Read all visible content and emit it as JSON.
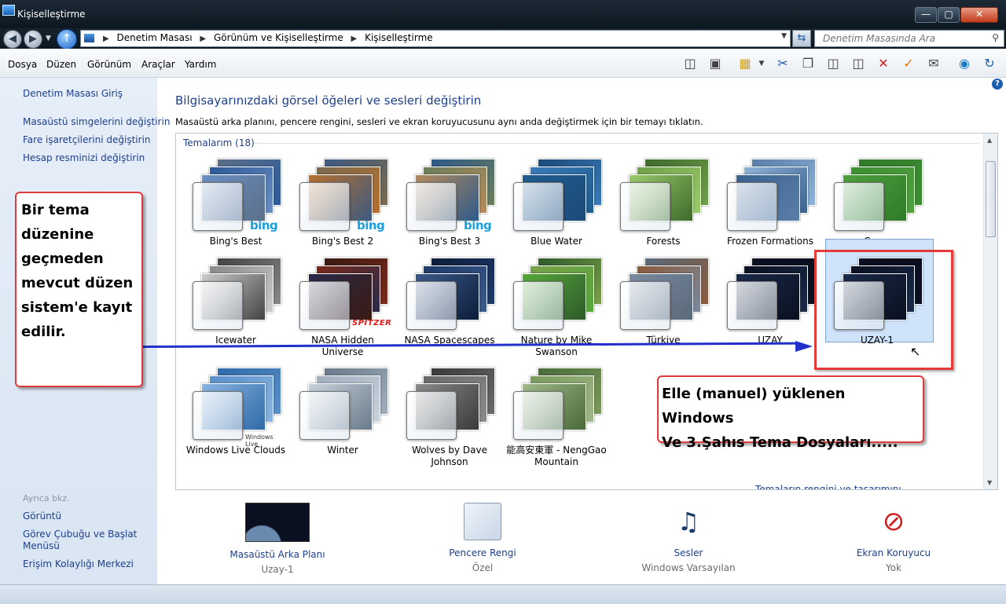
{
  "window": {
    "title": "Kişiselleştirme",
    "controls": {
      "minimize": "—",
      "maximize": "▢",
      "close": "✕"
    }
  },
  "address": {
    "crumbs": [
      "Denetim Masası",
      "Görünüm ve Kişiselleştirme",
      "Kişiselleştirme"
    ],
    "search_placeholder": "Denetim Masasında Ara"
  },
  "menu": [
    "Dosya",
    "Düzen",
    "Görünüm",
    "Araçlar",
    "Yardım"
  ],
  "toolbar_icons": [
    "panel-view-icon",
    "preview-pane-icon",
    "folder-icon",
    "scissors-icon",
    "copy-icon",
    "paste-icon",
    "paste-alt-icon",
    "delete-icon",
    "check-icon",
    "mail-icon",
    "globe-icon",
    "refresh-icon",
    "help-icon"
  ],
  "sidebar": {
    "home": "Denetim Masası Giriş",
    "tasks": [
      "Masaüstü simgelerini değiştirin",
      "Fare işaretçilerini değiştirin",
      "Hesap resminizi değiştirin"
    ],
    "see_also_title": "Ayrıca bkz.",
    "see_also": [
      "Görüntü",
      "Görev Çubuğu ve Başlat Menüsü",
      "Erişim Kolaylığı Merkezi"
    ]
  },
  "main": {
    "heading": "Bilgisayarınızdaki görsel öğeleri ve sesleri değiştirin",
    "subheading": "Masaüstü arka planını, pencere rengini, sesleri ve ekran koruyucusunu aynı anda değiştirmek için bir temayı tıklatın.",
    "group_label": "Temalarım (18)",
    "themes": [
      {
        "name": "Bing's Best",
        "brand": "bing",
        "colors": [
          "#5b6f88",
          "#2d5a9a",
          "#6a8fc2"
        ]
      },
      {
        "name": "Bing's Best 2",
        "brand": "bing",
        "colors": [
          "#3d5a80",
          "#7a6a50",
          "#b5702e"
        ]
      },
      {
        "name": "Bing's Best 3",
        "brand": "bing",
        "colors": [
          "#2e5a8a",
          "#6b7e5a",
          "#b48a5c"
        ]
      },
      {
        "name": "Blue Water",
        "brand": "",
        "colors": [
          "#1d4a7a",
          "#3a7ab8",
          "#1f5c8e"
        ]
      },
      {
        "name": "Forests",
        "brand": "",
        "colors": [
          "#3e6a2c",
          "#6fa04a",
          "#9acb6a"
        ]
      },
      {
        "name": "Frozen Formations",
        "brand": "",
        "colors": [
          "#5a7ea8",
          "#8eb3d8",
          "#3b6390"
        ]
      },
      {
        "name": "Grass",
        "brand": "",
        "colors": [
          "#2f7a2a",
          "#3f8e33",
          "#4ea03d"
        ]
      },
      {
        "name": "Icewater",
        "brand": "",
        "colors": [
          "#444444",
          "#888888",
          "#cccccc"
        ]
      },
      {
        "name": "NASA Hidden Universe",
        "brand": "SPITZER",
        "colors": [
          "#3a1a12",
          "#7a2a1a",
          "#2a2a4a"
        ]
      },
      {
        "name": "NASA Spacescapes",
        "brand": "",
        "colors": [
          "#0d1d3a",
          "#1f3a6a",
          "#3a5a8a"
        ]
      },
      {
        "name": "Nature by Mike Swanson",
        "brand": "",
        "colors": [
          "#2e5a2a",
          "#7aa04a",
          "#56a83a"
        ]
      },
      {
        "name": "Türkiye",
        "brand": "",
        "colors": [
          "#5a6a7a",
          "#8a5a3a",
          "#7a8aa0"
        ]
      },
      {
        "name": "UZAY",
        "brand": "",
        "colors": [
          "#0a1020",
          "#0a1020",
          "#1a2a4a"
        ]
      },
      {
        "name": "UZAY-1",
        "brand": "",
        "colors": [
          "#0a1020",
          "#0a1020",
          "#1a2a4a"
        ],
        "selected": true
      },
      {
        "name": "Windows Live Clouds",
        "brand": "Windows Live",
        "colors": [
          "#2e6aa8",
          "#5b8fc8",
          "#8ab4e0"
        ]
      },
      {
        "name": "Winter",
        "brand": "",
        "colors": [
          "#6a7a8a",
          "#a0aebc",
          "#c8d2dc"
        ]
      },
      {
        "name": "Wolves by Dave Johnson",
        "brand": "",
        "colors": [
          "#3a3a3a",
          "#6a6a6a",
          "#8a8a8a"
        ]
      },
      {
        "name": "能高安東軍 - NengGao Mountain",
        "brand": "",
        "colors": [
          "#4a6a3a",
          "#7a9a5a",
          "#a0b88a"
        ]
      }
    ],
    "truncated_link": "Temaların rengini ve tasarımını değiştirin"
  },
  "settings": [
    {
      "label": "Masaüstü Arka Planı",
      "value": "Uzay-1",
      "icon": "desktop-background-icon"
    },
    {
      "label": "Pencere Rengi",
      "value": "Özel",
      "icon": "window-color-icon"
    },
    {
      "label": "Sesler",
      "value": "Windows Varsayılan",
      "icon": "sounds-icon"
    },
    {
      "label": "Ekran Koruyucu",
      "value": "Yok",
      "icon": "screensaver-icon"
    }
  ],
  "annotations": {
    "left": "Bir tema düzenine geçmeden mevcut düzen sistem'e kayıt edilir.",
    "right": "Elle (manuel) yüklenen Windows\nVe 3.Şahıs Tema Dosyaları.....",
    "color": "#e33a3a",
    "arrow_color": "#2030c8"
  }
}
